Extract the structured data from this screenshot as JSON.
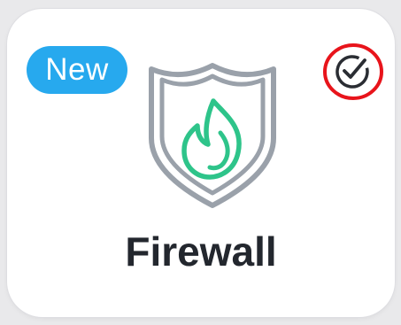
{
  "card": {
    "title": "Firewall",
    "badge": "New",
    "status_icon": "check-circle-icon",
    "main_icon": "shield-flame-icon"
  },
  "colors": {
    "badge_bg": "#27a9ee",
    "shield_stroke": "#9aa1aa",
    "flame_stroke": "#2ec48a",
    "status_ring": "#e8141b",
    "title_text": "#23272e"
  }
}
